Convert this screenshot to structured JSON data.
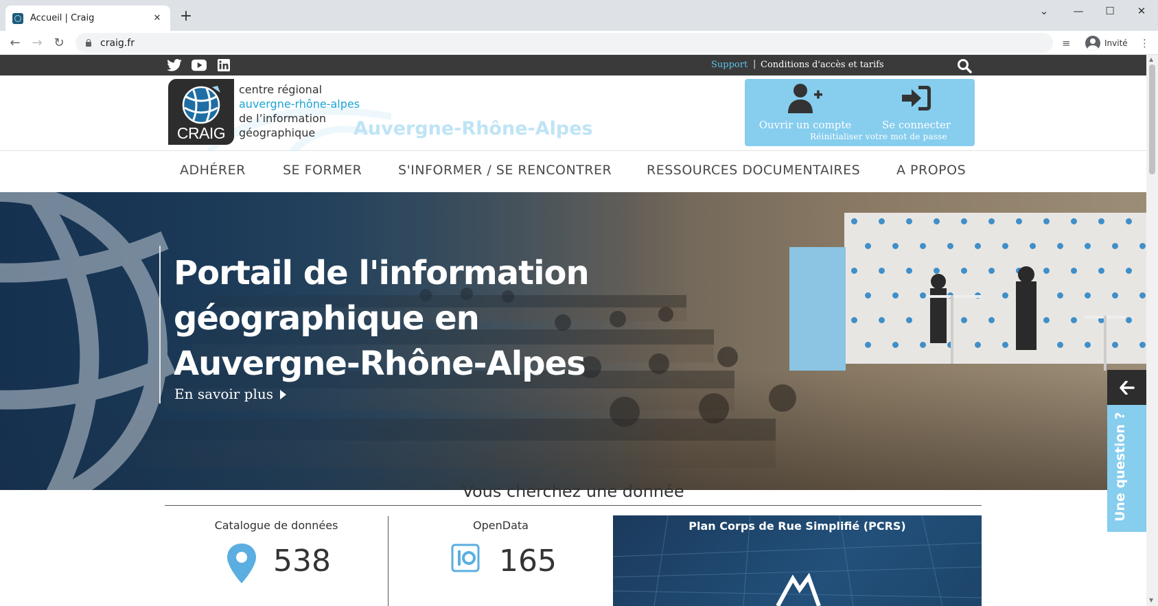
{
  "browser": {
    "tab_title": "Accueil | Craig",
    "url": "craig.fr",
    "profile_label": "Invité",
    "new_tab_symbol": "+",
    "close_symbol": "✕",
    "window_controls": {
      "chevron": "⌄",
      "minimize": "—",
      "maximize": "☐",
      "close": "✕"
    }
  },
  "topbar": {
    "social_icons": [
      "twitter-icon",
      "youtube-icon",
      "linkedin-icon"
    ],
    "support": "Support",
    "separator": "|",
    "conditions": "Conditions d'accès et tarifs"
  },
  "header": {
    "logo_word": "CRAIG",
    "org_line1": "centre régional",
    "org_line2": "auvergne-rhône-alpes",
    "org_line3": "de l’information",
    "org_line4": "géographique",
    "region_mark": "Auvergne-Rhône-Alpes",
    "account": {
      "open": "Ouvrir un compte",
      "login": "Se connecter",
      "reset": "Réinitialiser votre mot de passe"
    }
  },
  "nav": {
    "items": [
      "ADHÉRER",
      "SE FORMER",
      "S'INFORMER / SE RENCONTRER",
      "RESSOURCES DOCUMENTAIRES",
      "A PROPOS"
    ]
  },
  "hero": {
    "title": "Portail de l'information géographique en Auvergne-Rhône-Alpes",
    "more": "En savoir plus"
  },
  "question_tab": "Une question ?",
  "data_section": {
    "title": "Vous cherchez une donnée",
    "catalogue_title": "Catalogue de données",
    "catalogue_count": "538",
    "opendata_title": "OpenData",
    "opendata_count": "165",
    "pcrs_title": "Plan Corps de Rue Simplifié (PCRS)"
  },
  "colors": {
    "accent_blue": "#86cdee",
    "link_blue": "#1aa3d2",
    "topbar_dark": "#3a3a3a"
  }
}
